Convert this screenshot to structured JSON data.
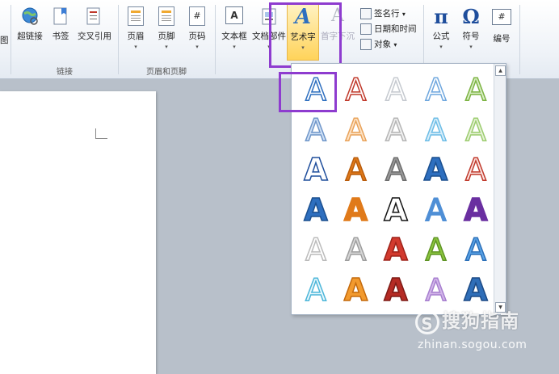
{
  "ribbon": {
    "partial_left_label": "图",
    "links_group": {
      "label": "链接",
      "items": [
        {
          "label": "超链接",
          "icon": "globe-link-icon"
        },
        {
          "label": "书签",
          "icon": "bookmark-icon"
        },
        {
          "label": "交叉引用",
          "icon": "cross-reference-icon"
        }
      ]
    },
    "header_footer_group": {
      "label": "页眉和页脚",
      "items": [
        {
          "label": "页眉",
          "icon": "header-icon"
        },
        {
          "label": "页脚",
          "icon": "footer-icon"
        },
        {
          "label": "页码",
          "icon": "page-number-icon",
          "glyph": "#"
        }
      ]
    },
    "text_group": {
      "items": [
        {
          "label": "文本框",
          "icon": "textbox-icon",
          "glyph": "A"
        },
        {
          "label": "文档部件",
          "icon": "quick-parts-icon"
        },
        {
          "label": "艺术字",
          "icon": "wordart-icon",
          "glyph": "A"
        },
        {
          "label": "首字下沉",
          "icon": "drop-cap-icon",
          "glyph": "A"
        }
      ],
      "small": [
        {
          "label": "签名行",
          "icon": "signature-line-icon",
          "arrow": "▾"
        },
        {
          "label": "日期和时间",
          "icon": "date-time-icon"
        },
        {
          "label": "对象",
          "icon": "object-icon",
          "arrow": "▾"
        }
      ]
    },
    "symbols_group": {
      "items": [
        {
          "label": "公式",
          "icon": "equation-icon",
          "glyph": "π"
        },
        {
          "label": "符号",
          "icon": "symbol-icon",
          "glyph": "Ω"
        },
        {
          "label": "编号",
          "icon": "numbering-icon",
          "glyph": "#"
        }
      ]
    },
    "dropdown_arrow": "▾"
  },
  "wordart_gallery": {
    "glyph": "A",
    "scroll_up": "▲",
    "scroll_down": "▼",
    "styles": [
      [
        "outline-blue",
        "outline-red",
        "outline-light-gray",
        "outline-light-blue",
        "green-glow"
      ],
      [
        "soft-blue",
        "soft-orange",
        "soft-gray",
        "soft-cyan",
        "soft-green"
      ],
      [
        "blue-white-fill",
        "orange-gradient",
        "gray-gradient",
        "blue-gradient",
        "red-white-fill"
      ],
      [
        "blue-bold",
        "orange-solid",
        "black-white-outline",
        "blue-light",
        "purple-reflection"
      ],
      [
        "light-gray-outline",
        "silver",
        "red-bevel",
        "green-bevel",
        "blue-reflection"
      ],
      [
        "cyan-outline",
        "orange-bevel",
        "dark-red-bevel",
        "lilac-soft",
        "blue-reflection-dark"
      ]
    ],
    "colors": {
      "highlight": "#8e3ccf",
      "blue": "#2e6fbf",
      "orange": "#e07a1a",
      "red": "#c0392b",
      "green": "#7cb342",
      "purple": "#6a2fa0"
    }
  },
  "watermark": {
    "logo": "S",
    "text": "搜狗指南",
    "url": "zhinan.sogou.com"
  }
}
